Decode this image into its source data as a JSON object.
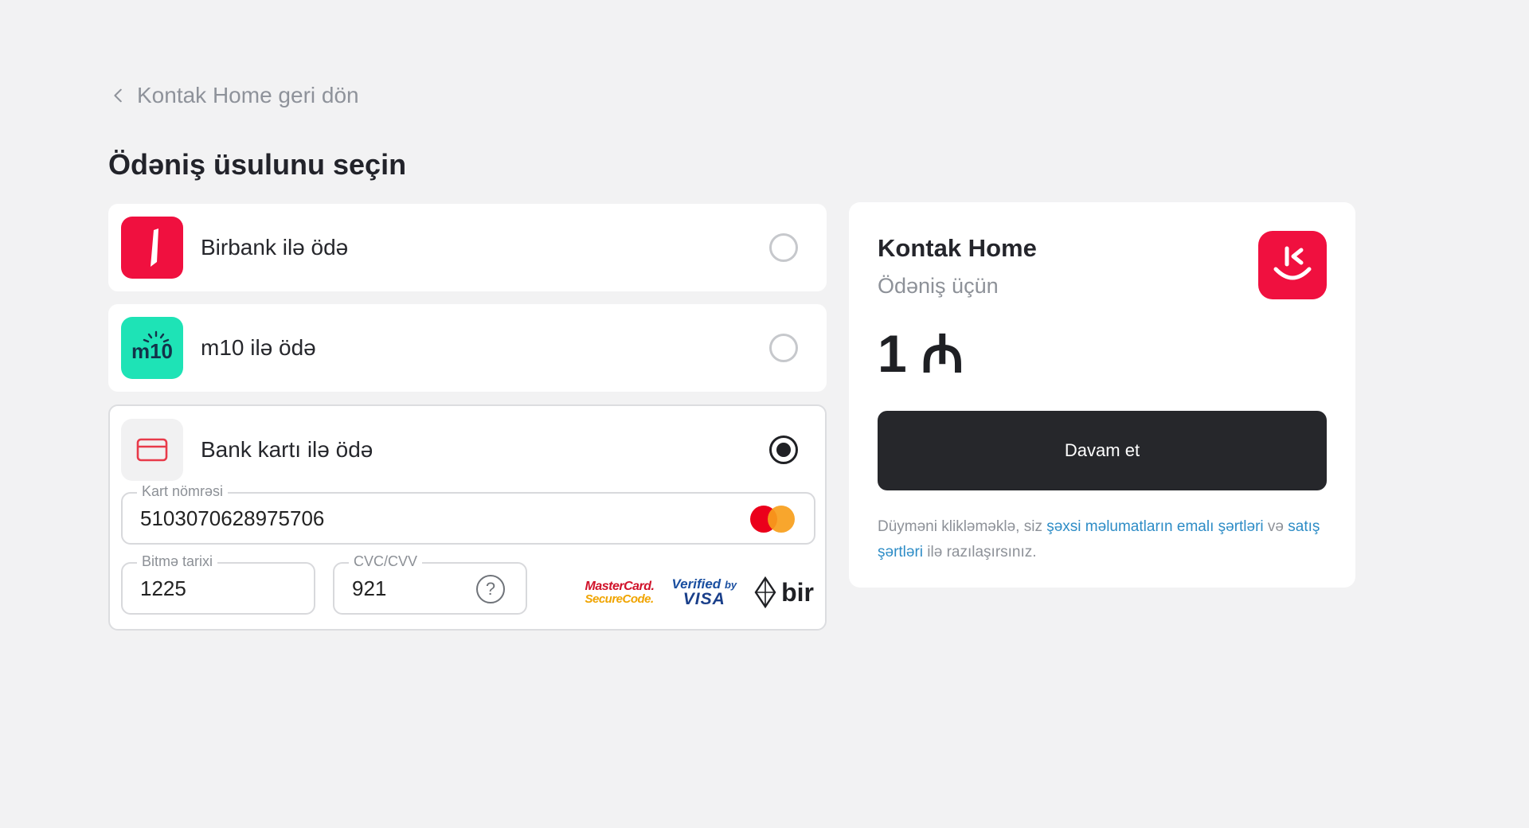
{
  "back_link": {
    "label": "Kontak Home geri dön"
  },
  "page_title": "Ödəniş üsulunu seçin",
  "methods": [
    {
      "id": "birbank",
      "label": "Birbank ilə ödə",
      "selected": false,
      "logo_color": "#f0103f"
    },
    {
      "id": "m10",
      "label": "m10 ilə ödə",
      "selected": false,
      "logo_color": "#1ee3b6",
      "logo_text": "m10"
    },
    {
      "id": "card",
      "label": "Bank kartı ilə ödə",
      "selected": true
    }
  ],
  "card_form": {
    "card_number": {
      "label": "Kart nömrəsi",
      "value": "5103070628975706"
    },
    "expiry": {
      "label": "Bitmə tarixi",
      "value": "1225"
    },
    "cvc": {
      "label": "CVC/CVV",
      "value": "921",
      "help_icon": "?"
    },
    "badges": {
      "mastercard_securecode": {
        "line1": "MasterCard.",
        "line2": "SecureCode."
      },
      "verified_by_visa": {
        "line1": "Verified",
        "line1_small": "by",
        "line2": "VISA"
      },
      "bir": "bir"
    }
  },
  "summary": {
    "merchant": "Kontak Home",
    "purpose": "Ödəniş üçün",
    "amount": "1",
    "currency_symbol": "₼",
    "pay_button": "Davam et",
    "terms": {
      "before": "Düyməni klikləməklə, siz ",
      "link1": "şəxsi məlumatların emalı şərtləri",
      "middle": " və ",
      "link2": "satış şərtləri",
      "after": " ilə razılaşırsınız."
    }
  },
  "colors": {
    "accent_red": "#f0103f",
    "button_dark": "#26272b",
    "link_blue": "#2d8cc6"
  }
}
